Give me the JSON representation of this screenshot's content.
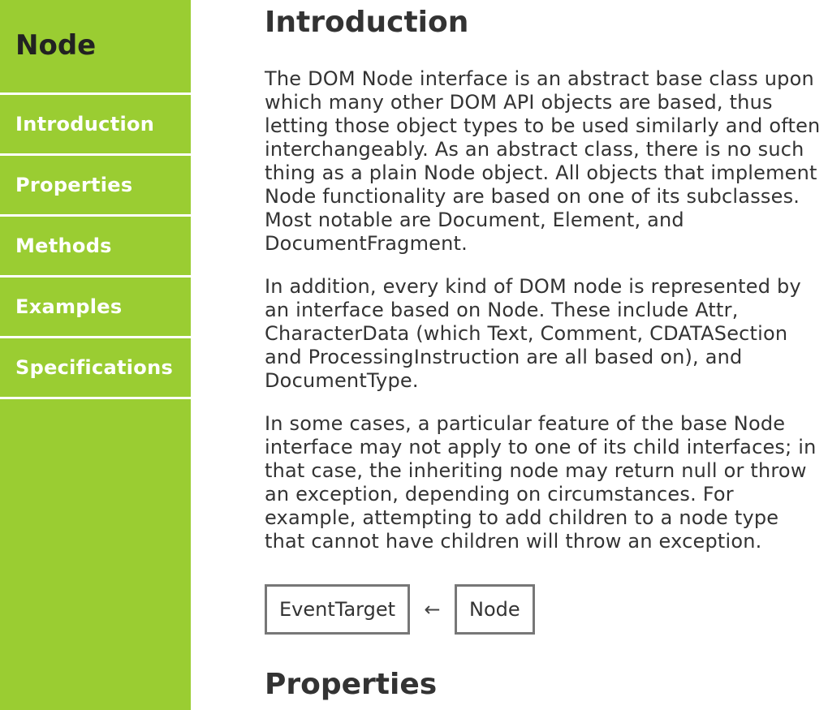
{
  "sidebar": {
    "title": "Node",
    "items": [
      {
        "label": "Introduction"
      },
      {
        "label": "Properties"
      },
      {
        "label": "Methods"
      },
      {
        "label": "Examples"
      },
      {
        "label": "Specifications"
      }
    ]
  },
  "main": {
    "intro_heading": "Introduction",
    "paragraphs": [
      "The DOM Node interface is an abstract base class upon which many other DOM API objects are based, thus letting those object types to be used similarly and often interchangeably. As an abstract class, there is no such thing as a plain Node object. All objects that implement Node functionality are based on one of its subclasses. Most notable are Document, Element, and DocumentFragment.",
      "In addition, every kind of DOM node is represented by an interface based on Node. These include Attr, CharacterData (which Text, Comment, CDATASection and ProcessingInstruction are all based on), and DocumentType.",
      "In some cases, a particular feature of the base Node interface may not apply to one of its child interfaces; in that case, the inheriting node may return null or throw an exception, depending on circumstances. For example, attempting to add children to a node type that cannot have children will throw an exception."
    ],
    "inheritance": {
      "parent": "EventTarget",
      "arrow": "←",
      "child": "Node"
    },
    "properties_heading": "Properties"
  },
  "colors": {
    "sidebar_bg": "#9acd32",
    "sidebar_text": "#ffffff",
    "body_text": "#333333",
    "box_border": "#777777"
  }
}
